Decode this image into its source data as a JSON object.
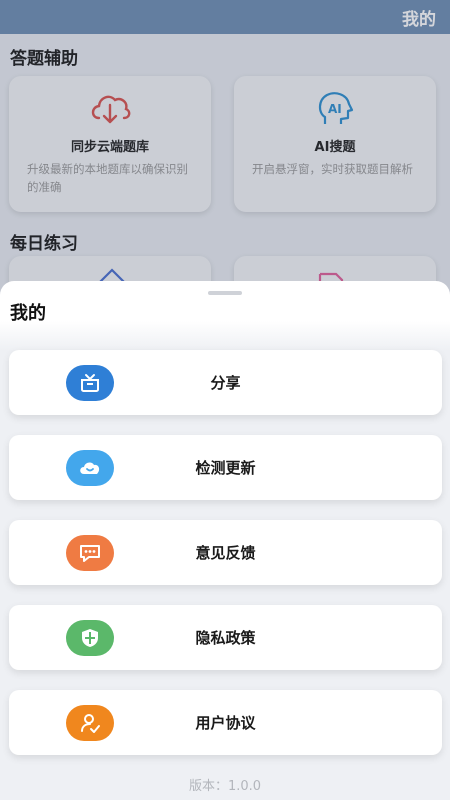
{
  "header": {
    "title": "我的"
  },
  "sections": [
    {
      "title": "答题辅助"
    },
    {
      "title": "每日练习"
    }
  ],
  "cards": [
    {
      "icon": "cloud-download-icon",
      "title": "同步云端题库",
      "desc": "升级最新的本地题库以确保识别的准确"
    },
    {
      "icon": "ai-head-icon",
      "title": "AI搜题",
      "desc": "开启悬浮窗，实时获取题目解析"
    }
  ],
  "sheet": {
    "title": "我的",
    "items": [
      {
        "label": "分享",
        "icon": "gift-icon",
        "color": "#2f7fd6"
      },
      {
        "label": "检测更新",
        "icon": "cloud-icon",
        "color": "#43a7ec"
      },
      {
        "label": "意见反馈",
        "icon": "chat-bubble-icon",
        "color": "#ef7b43"
      },
      {
        "label": "隐私政策",
        "icon": "shield-icon",
        "color": "#5bb86a"
      },
      {
        "label": "用户协议",
        "icon": "user-check-icon",
        "color": "#f0871e"
      }
    ],
    "version": "版本：1.0.0"
  }
}
